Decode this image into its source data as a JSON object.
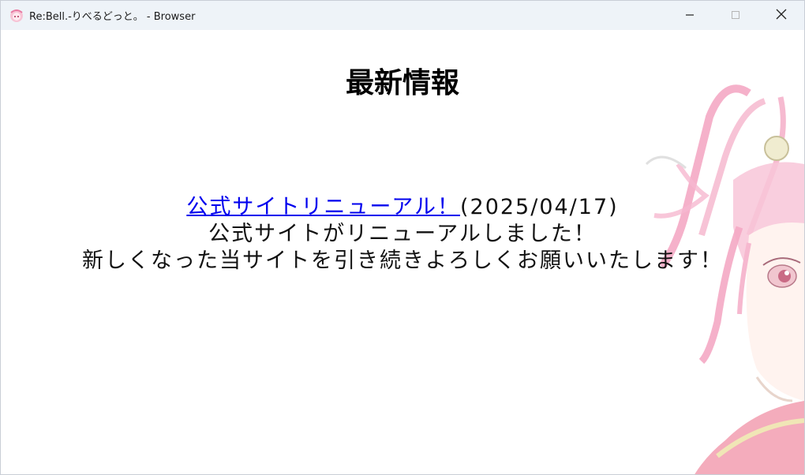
{
  "window": {
    "title": "Re:Bell.-りべるどっと。 - Browser",
    "controls": {
      "minimize": "minimize-icon",
      "maximize": "maximize-icon",
      "close": "close-icon"
    }
  },
  "page": {
    "heading": "最新情報",
    "news": [
      {
        "link_text": "公式サイトリニューアル！",
        "date": "(2025/04/17)",
        "lines": [
          "公式サイトがリニューアルしました！",
          "新しくなった当サイトを引き続きよろしくお願いいたします！"
        ]
      }
    ]
  },
  "colors": {
    "titlebar_bg": "#eef3f8",
    "link": "#0000ee",
    "accent_pink": "#f4a9c4"
  }
}
